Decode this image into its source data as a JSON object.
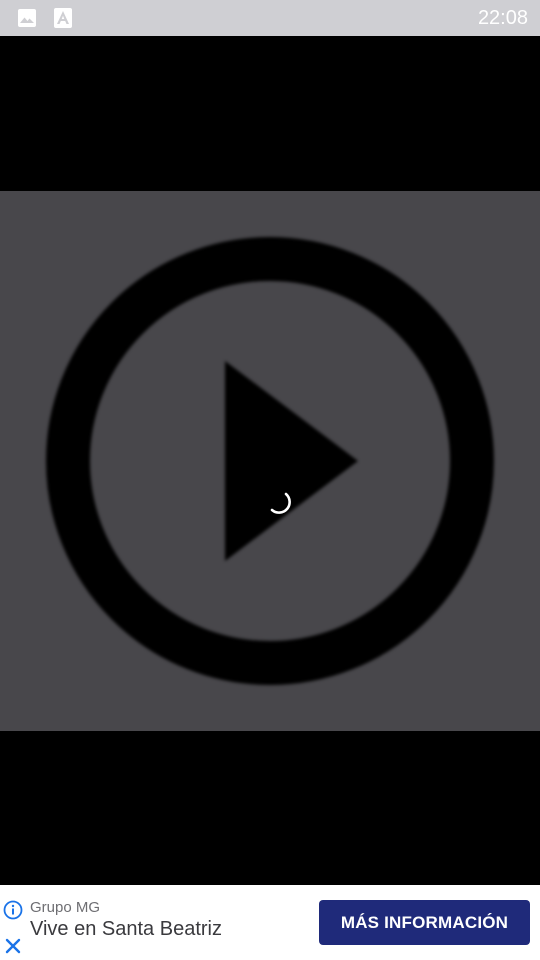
{
  "status_bar": {
    "time": "22:08",
    "icons": [
      "image-icon",
      "app-store-icon"
    ],
    "background": "#cfcfd3"
  },
  "video": {
    "thumbnail_background": "#48474b",
    "icon": "play-circle-icon",
    "loading": "loading-spinner-icon"
  },
  "ad": {
    "advertiser": "Grupo MG",
    "headline": "Vive en Santa Beatriz",
    "cta_label": "MÁS INFORMACIÓN",
    "cta_color": "#1f2a7a",
    "accent_color": "#1a73e8"
  }
}
